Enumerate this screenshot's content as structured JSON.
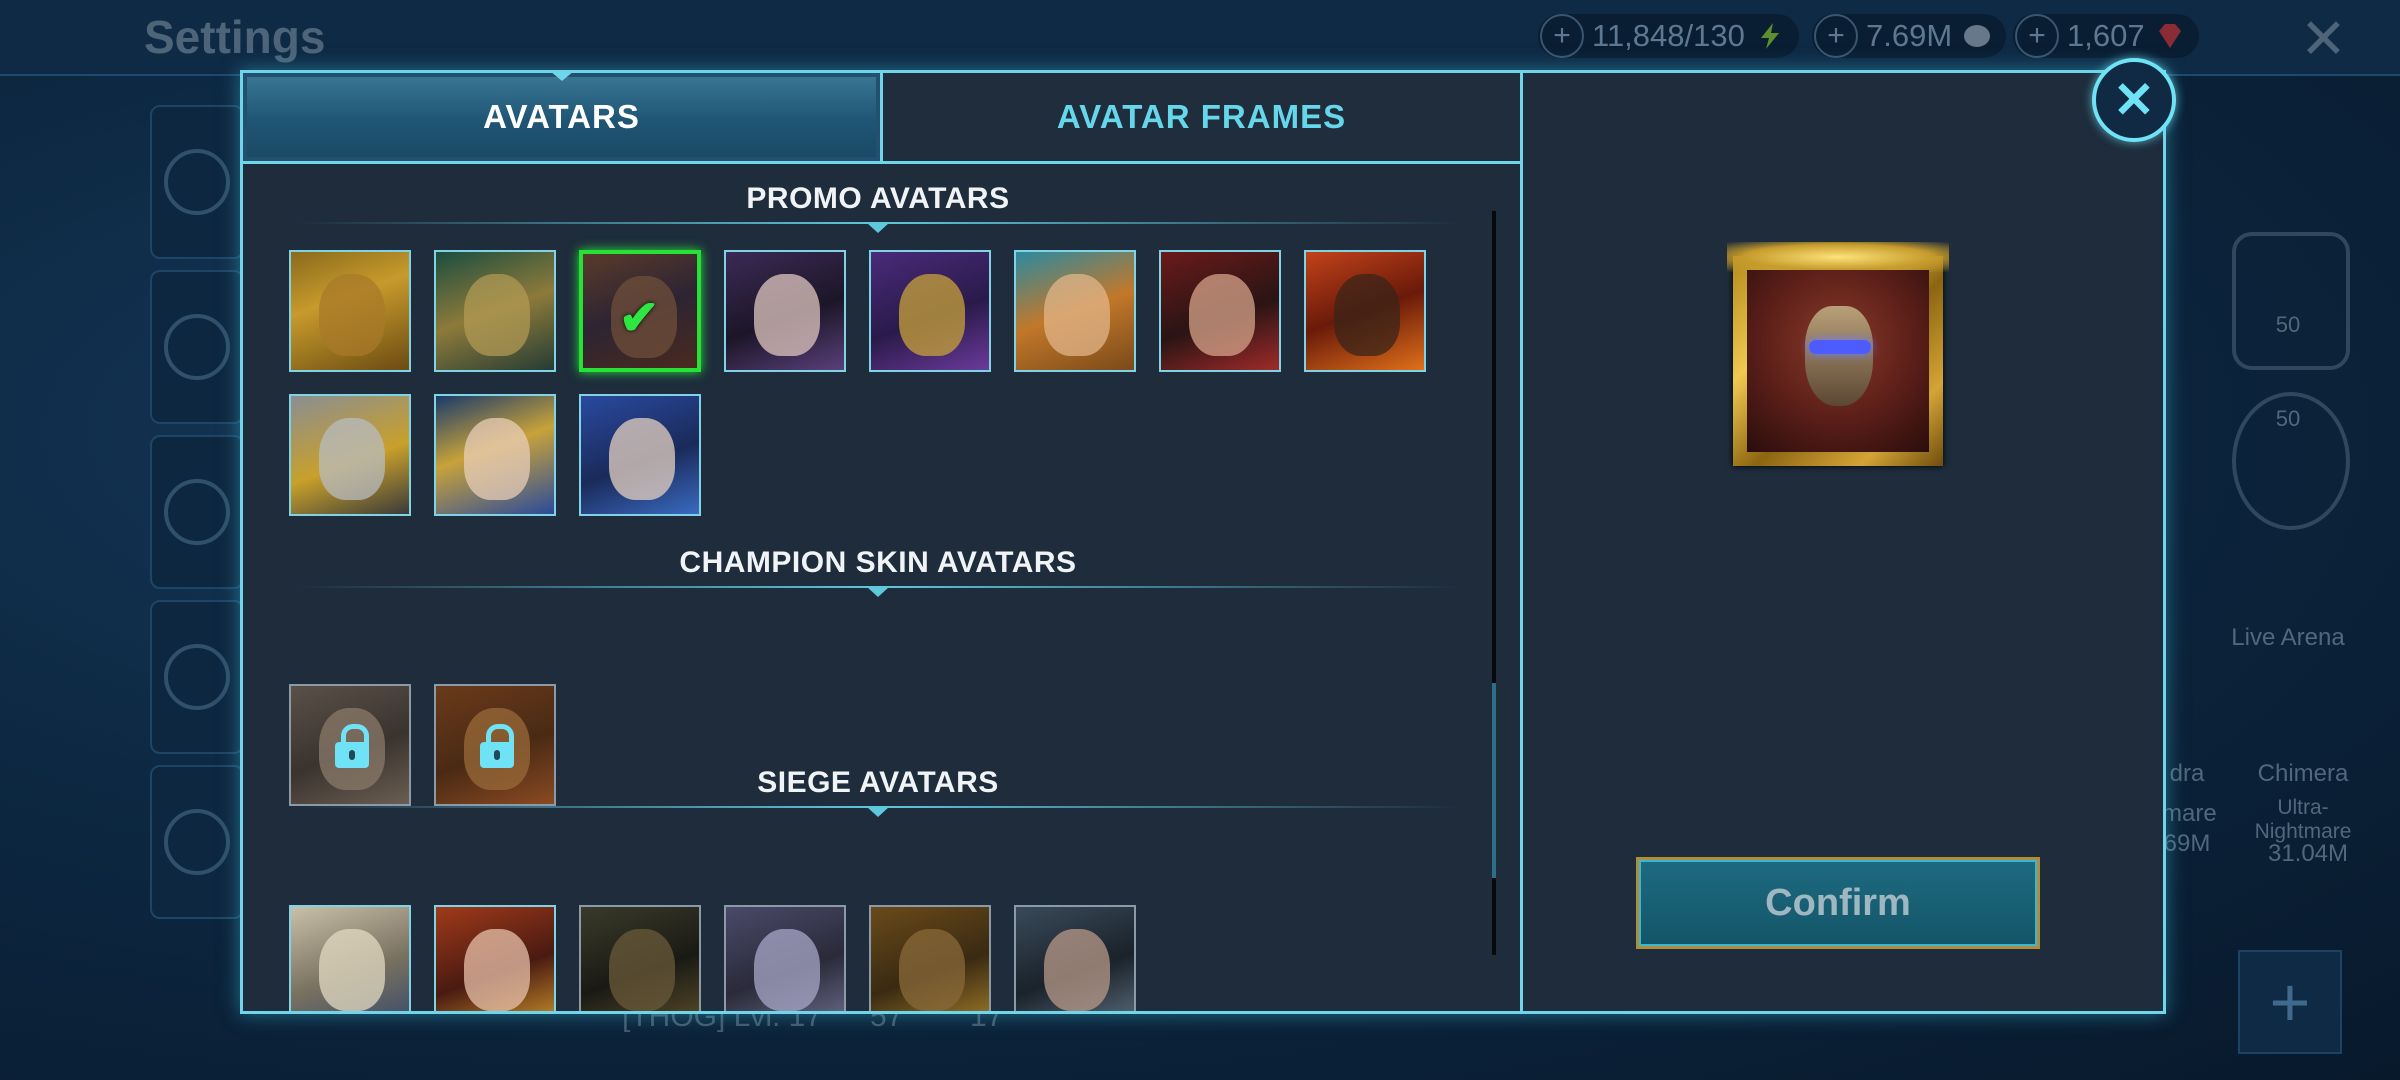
{
  "background": {
    "title": "Settings",
    "resources": [
      {
        "value": "11,848/130",
        "icon": "lightning-icon",
        "color": "#7ac63a"
      },
      {
        "value": "7.69M",
        "icon": "silver-coin-icon",
        "color": "#9aa7b6"
      },
      {
        "value": "1,607",
        "icon": "gem-icon",
        "color": "#d13b4a"
      }
    ],
    "side_icons": [
      "profile-icon",
      "user-icon",
      "gear-icon",
      "info-icon",
      "globe-icon"
    ],
    "bottom_text": "[THOG] Lvl. 17",
    "bottom_stats": [
      "57",
      "17"
    ],
    "right_labels": {
      "live_arena": "Live Arena",
      "chimera": "Chimera",
      "chimera_difficulty": "Ultra-\nNightmare",
      "chimera_damage": "31.04M",
      "hydra_partial": "dra",
      "hydra_difficulty_partial": "mare",
      "hydra_damage_partial": "69M",
      "emblem_level_1": "50",
      "emblem_level_2": "50"
    }
  },
  "modal": {
    "tabs": [
      {
        "label": "AVATARS",
        "active": true
      },
      {
        "label": "AVATAR FRAMES",
        "active": false
      }
    ],
    "sections": [
      {
        "title": "PROMO AVATARS",
        "count": 11,
        "selected_index": 2
      },
      {
        "title": "CHAMPION SKIN AVATARS",
        "count": 2,
        "locked": true
      },
      {
        "title": "SIEGE AVATARS",
        "count": 6
      }
    ],
    "confirm_label": "Confirm",
    "close_icon": "close-icon",
    "colors": {
      "accent": "#6fd5e8",
      "selected": "#27e236",
      "panel": "#1e2c3c"
    }
  }
}
